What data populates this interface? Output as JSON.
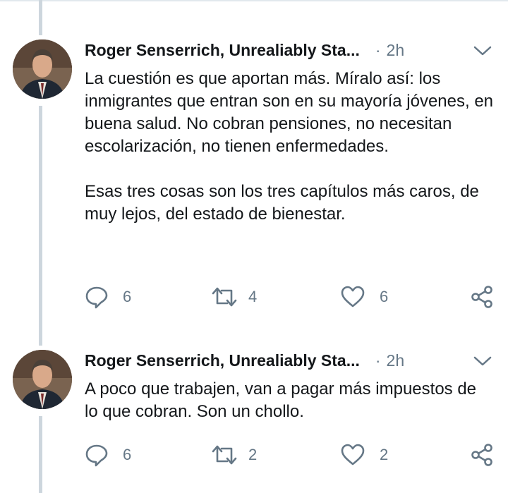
{
  "colors": {
    "text": "#14171a",
    "muted": "#657786",
    "thread_line": "#cdd6dd",
    "border": "#e1e8ed"
  },
  "tweets": [
    {
      "author": "Roger Senserrich, Unrealiably Sta...",
      "dot": "·",
      "time": "2h",
      "paragraphs": [
        "La cuestión es que aportan más. Míralo así: los inmigrantes que entran son en su mayoría jóvenes, en buena salud. No cobran pensiones, no necesitan escolarización, no tienen enfermedades.",
        "Esas tres cosas son los tres capítulos más caros, de muy lejos, del estado de bienestar."
      ],
      "replies": "6",
      "retweets": "4",
      "likes": "6",
      "icons": {
        "reply": "reply-icon",
        "retweet": "retweet-icon",
        "like": "heart-icon",
        "share": "share-icon",
        "menu": "chevron-down-icon"
      }
    },
    {
      "author": "Roger Senserrich, Unrealiably Sta...",
      "dot": "·",
      "time": "2h",
      "paragraphs": [
        "A poco que trabajen, van a pagar más impuestos de lo que cobran. Son un chollo."
      ],
      "replies": "6",
      "retweets": "2",
      "likes": "2",
      "icons": {
        "reply": "reply-icon",
        "retweet": "retweet-icon",
        "like": "heart-icon",
        "share": "share-icon",
        "menu": "chevron-down-icon"
      }
    }
  ]
}
